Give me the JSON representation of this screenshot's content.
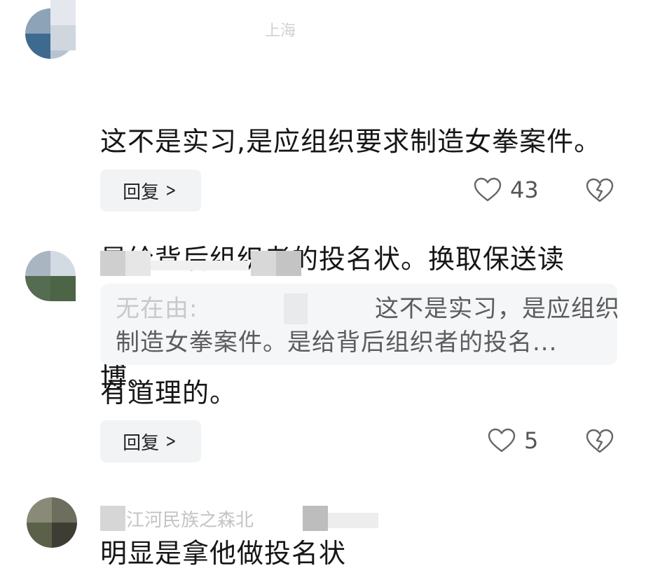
{
  "comments": [
    {
      "location": "上海",
      "text_lines": [
        "这不是实习,是应组织要求制造女拳案件。",
        "是给背后组织者的投名状。换取保送读",
        "博。"
      ],
      "reply_label": "回复",
      "likes": "43"
    },
    {
      "quote_author_fragment": "无在由:",
      "quote_text_lines": [
        "这不是实习，是应组织要求",
        "制造女拳案件。是给背后组织者的投名..."
      ],
      "text": "有道理的。",
      "reply_label": "回复",
      "likes": "5"
    },
    {
      "username_fragment": "江河民族之森北",
      "text": "明显是拿他做投名状"
    }
  ],
  "icons": {
    "reply_chevron": "chevron-right-icon",
    "like": "heart-outline-icon",
    "dislike": "broken-heart-icon"
  },
  "colors": {
    "reply_bg": "#f2f3f5",
    "quote_bg": "#f5f6f8",
    "text": "#161616",
    "muted": "#5c5c5c"
  }
}
